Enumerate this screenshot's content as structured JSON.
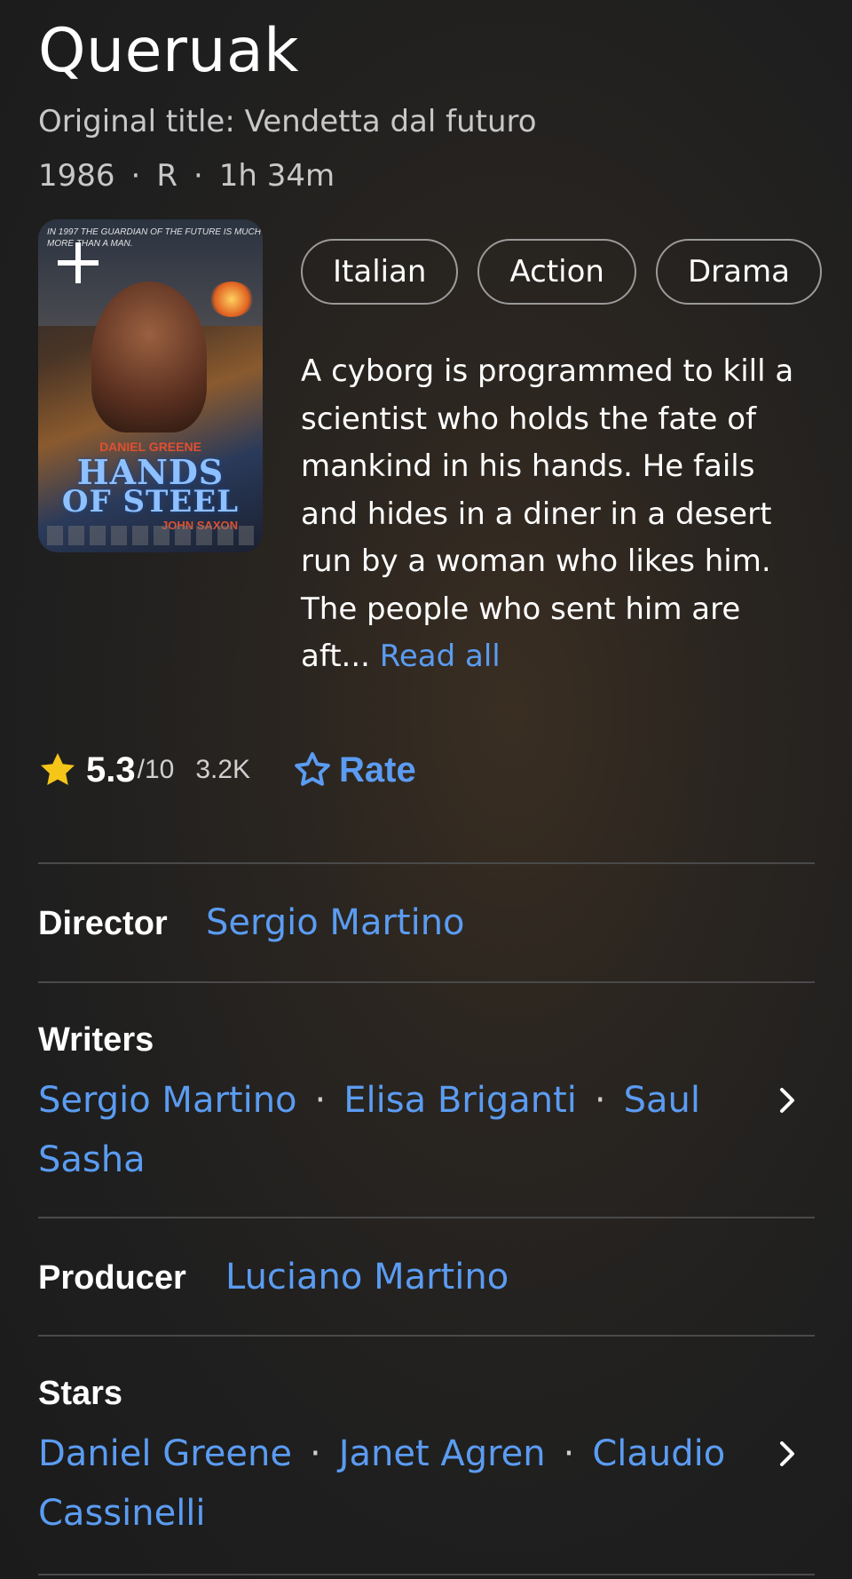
{
  "movie": {
    "title": "Queruak",
    "original_title": "Original title: Vendetta dal futuro",
    "year": "1986",
    "rating_cert": "R",
    "runtime": "1h 34m",
    "separator": "·"
  },
  "poster": {
    "tagline": "IN 1997 THE GUARDIAN OF THE FUTURE IS MUCH MORE THAN A MAN.",
    "actor": "DANIEL GREENE",
    "title_line1": "HANDS",
    "title_line2": "OF STEEL",
    "costar": "JOHN SAXON"
  },
  "genres": [
    "Italian",
    "Action",
    "Drama"
  ],
  "plot": {
    "text": "A cyborg is programmed to kill a scientist who holds the fate of mankind in his hands. He fails and hides in a diner in a desert run by a woman who likes him. The people who sent him are aft...",
    "read_all": "Read all"
  },
  "rating": {
    "score": "5.3",
    "out_of": "/10",
    "votes": "3.2K",
    "rate_label": "Rate"
  },
  "credits": {
    "director_label": "Director",
    "director": "Sergio Martino",
    "writers_label": "Writers",
    "writers": [
      "Sergio Martino",
      "Elisa Briganti",
      "Saul Sasha"
    ],
    "producer_label": "Producer",
    "producer": "Luciano Martino",
    "stars_label": "Stars",
    "stars": [
      "Daniel Greene",
      "Janet Agren",
      "Claudio Cassinelli"
    ]
  },
  "colors": {
    "link": "#5b9cf2",
    "star": "#f5c518",
    "background": "#1f1f1f"
  }
}
